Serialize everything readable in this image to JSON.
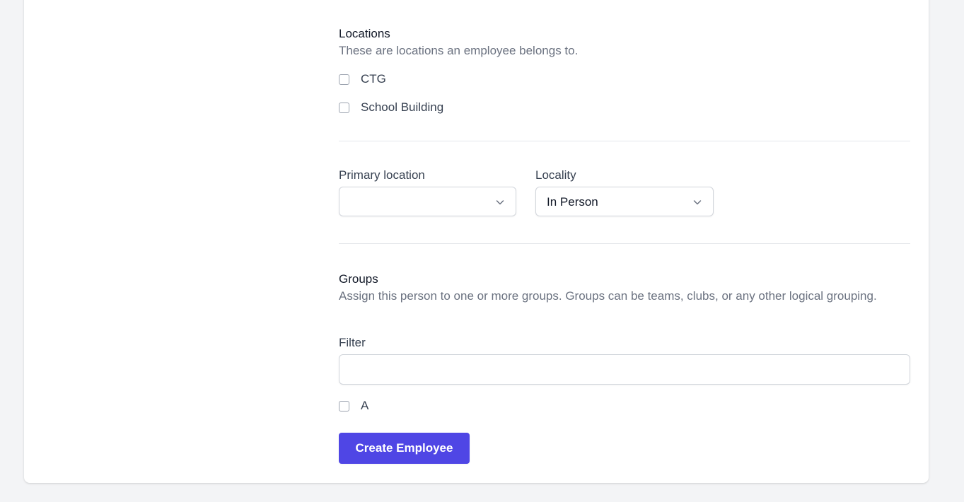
{
  "locations": {
    "title": "Locations",
    "description": "These are locations an employee belongs to.",
    "options": [
      {
        "label": "CTG",
        "checked": false
      },
      {
        "label": "School Building",
        "checked": false
      }
    ]
  },
  "primary_location": {
    "label": "Primary location",
    "value": ""
  },
  "locality": {
    "label": "Locality",
    "value": "In Person"
  },
  "groups": {
    "title": "Groups",
    "description": "Assign this person to one or more groups. Groups can be teams, clubs, or any other logical grouping.",
    "filter_label": "Filter",
    "filter_value": "",
    "options": [
      {
        "label": "A",
        "checked": false
      }
    ]
  },
  "submit_label": "Create Employee",
  "colors": {
    "accent": "#4f46e5",
    "page_bg": "#f3f4f6",
    "muted_text": "#6b7280"
  }
}
